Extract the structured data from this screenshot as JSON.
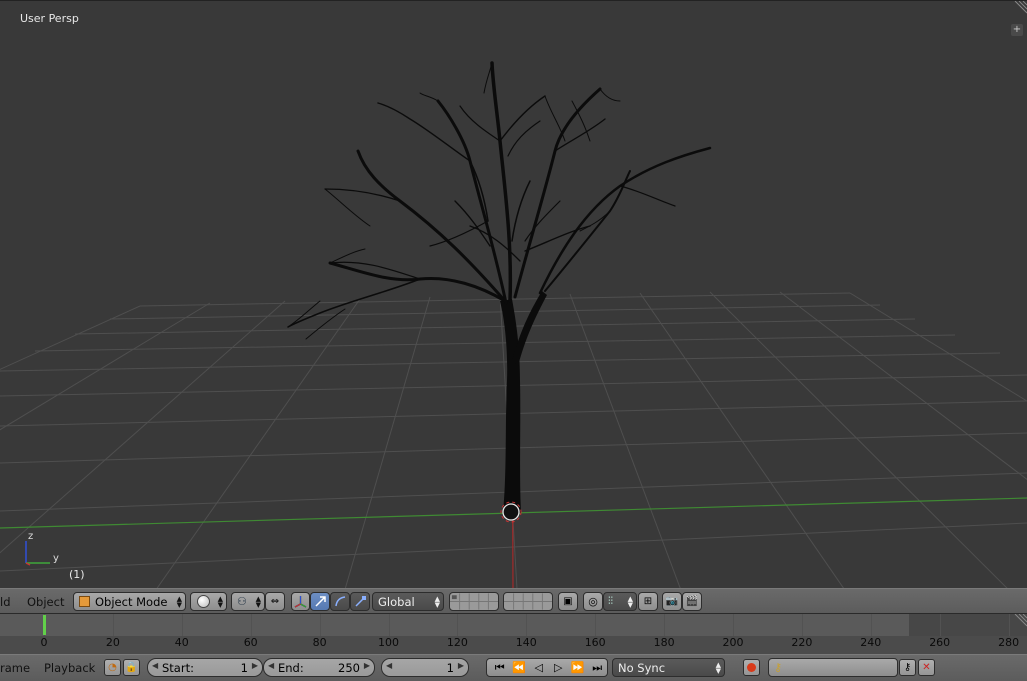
{
  "viewport": {
    "view_name": "User Persp",
    "frame_indicator": "(1)",
    "axis_labels": {
      "z": "z",
      "y": "y"
    },
    "colors": {
      "background": "#393939",
      "grid": "#4f4f4f",
      "x_axis": "#b23333",
      "y_axis": "#4a9a3a",
      "tree": "#0a0a0a"
    }
  },
  "header3d": {
    "menus": [
      "ld",
      "Object"
    ],
    "mode": "Object Mode",
    "transform_orientation": "Global",
    "icons": [
      "mode-cube-icon",
      "shading-sphere-icon",
      "pivot-icon",
      "manipulator-icon",
      "translate-icon",
      "rotate-icon",
      "scale-icon",
      "layers-icon",
      "lock-icon",
      "snap-icon",
      "proportional-icon",
      "render-icon",
      "camera-icon"
    ]
  },
  "timeline": {
    "current_frame_marker": 0,
    "ticks": [
      "0",
      "20",
      "40",
      "60",
      "80",
      "100",
      "120",
      "140",
      "160",
      "180",
      "200",
      "220",
      "240",
      "260",
      "280"
    ]
  },
  "header_tl": {
    "menus": [
      "rame",
      "Playback"
    ],
    "start_label": "Start:",
    "start_value": "1",
    "end_label": "End:",
    "end_value": "250",
    "current_frame": "1",
    "sync": "No Sync"
  }
}
